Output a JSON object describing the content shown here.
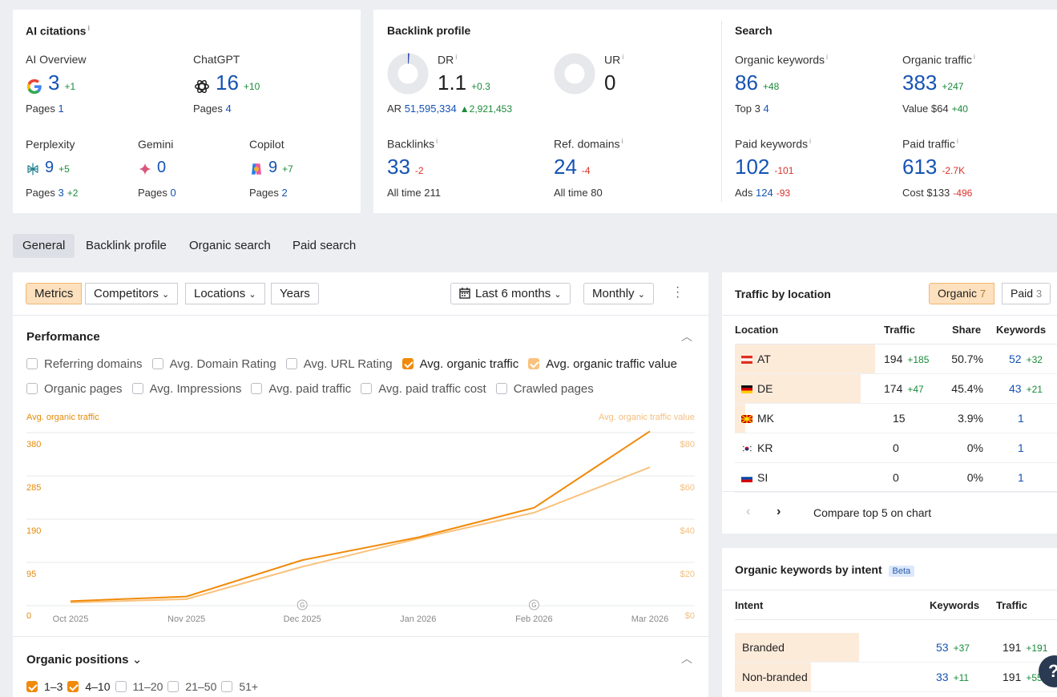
{
  "ai_citations": {
    "title": "AI citations",
    "info": "i",
    "items": [
      {
        "name": "AI Overview",
        "value": "3",
        "delta": "+1",
        "pages_label": "Pages",
        "pages": "1",
        "pages_delta": ""
      },
      {
        "name": "ChatGPT",
        "value": "16",
        "delta": "+10",
        "pages_label": "Pages",
        "pages": "4",
        "pages_delta": ""
      },
      {
        "name": "Perplexity",
        "value": "9",
        "delta": "+5",
        "pages_label": "Pages",
        "pages": "3",
        "pages_delta": "+2"
      },
      {
        "name": "Gemini",
        "value": "0",
        "delta": "",
        "pages_label": "Pages",
        "pages": "0",
        "pages_delta": ""
      },
      {
        "name": "Copilot",
        "value": "9",
        "delta": "+7",
        "pages_label": "Pages",
        "pages": "2",
        "pages_delta": ""
      }
    ]
  },
  "backlink_profile": {
    "title": "Backlink profile",
    "dr_label": "DR",
    "dr_value": "1.1",
    "dr_delta": "+0.3",
    "dr_fill": 0.011,
    "ur_label": "UR",
    "ur_value": "0",
    "ur_fill": 0,
    "ar_label": "AR",
    "ar_value": "51,595,334",
    "ar_delta": "▲2,921,453",
    "backlinks_label": "Backlinks",
    "backlinks_value": "33",
    "backlinks_delta": "-2",
    "backlinks_all_label": "All time",
    "backlinks_all": "211",
    "ref_label": "Ref. domains",
    "ref_value": "24",
    "ref_delta": "-4",
    "ref_all_label": "All time",
    "ref_all": "80"
  },
  "search": {
    "title": "Search",
    "ok_label": "Organic keywords",
    "ok_value": "86",
    "ok_delta": "+48",
    "ok_sub_label": "Top 3",
    "ok_sub": "4",
    "ot_label": "Organic traffic",
    "ot_value": "383",
    "ot_delta": "+247",
    "ot_sub_label": "Value",
    "ot_sub": "$64",
    "ot_sub_delta": "+40",
    "pk_label": "Paid keywords",
    "pk_value": "102",
    "pk_delta": "-101",
    "pk_sub_label": "Ads",
    "pk_sub": "124",
    "pk_sub_delta": "-93",
    "pt_label": "Paid traffic",
    "pt_value": "613",
    "pt_delta": "-2.7K",
    "pt_sub_label": "Cost",
    "pt_sub": "$133",
    "pt_sub_delta": "-496"
  },
  "tabs": [
    "General",
    "Backlink profile",
    "Organic search",
    "Paid search"
  ],
  "toolbar": {
    "segments": [
      "Metrics",
      "Competitors",
      "Locations",
      "Years"
    ],
    "chevron": "⌄",
    "date_range": "Last 6 months",
    "interval": "Monthly"
  },
  "performance": {
    "title": "Performance",
    "options_row1": [
      {
        "label": "Referring domains",
        "state": "off"
      },
      {
        "label": "Avg. Domain Rating",
        "state": "off"
      },
      {
        "label": "Avg. URL Rating",
        "state": "off"
      },
      {
        "label": "Avg. organic traffic",
        "state": "on"
      },
      {
        "label": "Avg. organic traffic value",
        "state": "lt"
      }
    ],
    "options_row2": [
      {
        "label": "Organic pages",
        "state": "off"
      },
      {
        "label": "Avg. Impressions",
        "state": "off"
      },
      {
        "label": "Avg. paid traffic",
        "state": "off"
      },
      {
        "label": "Avg. paid traffic cost",
        "state": "off"
      },
      {
        "label": "Crawled pages",
        "state": "off"
      }
    ]
  },
  "chart_data": {
    "type": "line",
    "x": [
      "Oct 2025",
      "Nov 2025",
      "Dec 2025",
      "Jan 2026",
      "Feb 2026",
      "Mar 2026"
    ],
    "y_left_label": "Avg. organic traffic",
    "y_right_label": "Avg. organic traffic value",
    "y_left_ticks": [
      "0",
      "95",
      "190",
      "285",
      "380"
    ],
    "y_right_ticks": [
      "$0",
      "$20",
      "$40",
      "$60",
      "$80"
    ],
    "ylim_left": [
      0,
      380
    ],
    "ylim_right": [
      0,
      80
    ],
    "series": [
      {
        "name": "Avg. organic traffic",
        "axis": "left",
        "color": "#f08a0a",
        "values": [
          10,
          20,
          100,
          150,
          215,
          383
        ]
      },
      {
        "name": "Avg. organic traffic value",
        "axis": "right",
        "color": "#f9c27d",
        "values": [
          1.5,
          3,
          18,
          31,
          43,
          64
        ]
      }
    ],
    "annotations": [
      {
        "x": "Dec 2025",
        "icon": "G"
      },
      {
        "x": "Feb 2026",
        "icon": "G"
      }
    ],
    "grid": true
  },
  "organic_positions": {
    "title": "Organic positions",
    "chevron": "⌄",
    "options": [
      {
        "label": "1–3",
        "state": "on"
      },
      {
        "label": "4–10",
        "state": "on"
      },
      {
        "label": "11–20",
        "state": "off"
      },
      {
        "label": "21–50",
        "state": "off"
      },
      {
        "label": "51+",
        "state": "off"
      }
    ]
  },
  "traffic_by_location": {
    "title": "Traffic by location",
    "toggle_organic": "Organic",
    "toggle_organic_count": "7",
    "toggle_paid": "Paid",
    "toggle_paid_count": "3",
    "headers": [
      "Location",
      "Traffic",
      "Share",
      "Keywords"
    ],
    "rows": [
      {
        "code": "AT",
        "traffic": "194",
        "traffic_delta": "+185",
        "share": "50.7%",
        "share_fill": 0.507,
        "keywords": "52",
        "keywords_delta": "+32"
      },
      {
        "code": "DE",
        "traffic": "174",
        "traffic_delta": "+47",
        "share": "45.4%",
        "share_fill": 0.454,
        "keywords": "43",
        "keywords_delta": "+21"
      },
      {
        "code": "MK",
        "traffic": "15",
        "traffic_delta": "",
        "share": "3.9%",
        "share_fill": 0.039,
        "keywords": "1",
        "keywords_delta": ""
      },
      {
        "code": "KR",
        "traffic": "0",
        "traffic_delta": "",
        "share": "0%",
        "share_fill": 0,
        "keywords": "1",
        "keywords_delta": ""
      },
      {
        "code": "SI",
        "traffic": "0",
        "traffic_delta": "",
        "share": "0%",
        "share_fill": 0,
        "keywords": "1",
        "keywords_delta": ""
      }
    ],
    "compare_label": "Compare top 5 on chart"
  },
  "keywords_by_intent": {
    "title": "Organic keywords by intent",
    "badge": "Beta",
    "headers": [
      "Intent",
      "Keywords",
      "Traffic"
    ],
    "rows": [
      {
        "intent": "Branded",
        "keywords": "53",
        "keywords_delta": "+37",
        "traffic": "191",
        "traffic_delta": "+191",
        "fill": 0.62
      },
      {
        "intent": "Non-branded",
        "keywords": "33",
        "keywords_delta": "+11",
        "traffic": "191",
        "traffic_delta": "+55",
        "fill": 0.38
      }
    ]
  },
  "help_button": "?"
}
